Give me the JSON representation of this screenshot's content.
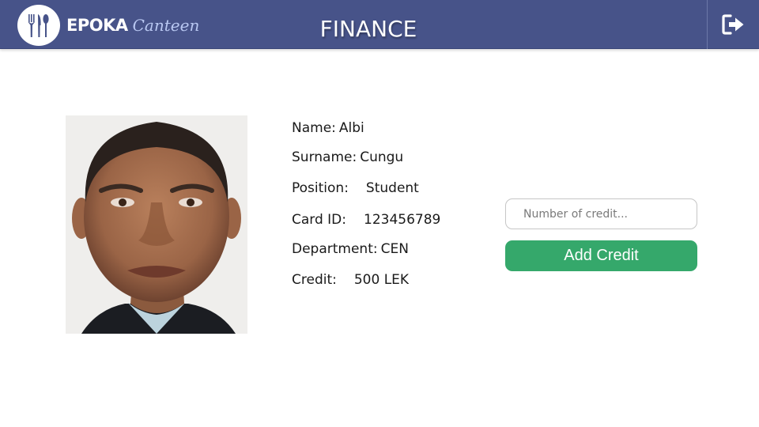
{
  "header": {
    "logo_brand": "EPOKA",
    "logo_sub": "Canteen",
    "title": "FINANCE",
    "logout_icon": "sign-out-icon"
  },
  "profile": {
    "photo_icon": "portrait-photo",
    "fields": [
      {
        "label": "Name:",
        "value": "Albi"
      },
      {
        "label": "Surname:",
        "value": "Cungu"
      },
      {
        "label": "Position:",
        "value": "Student"
      },
      {
        "label": "Card ID:",
        "value": "123456789"
      },
      {
        "label": "Department:",
        "value": "CEN"
      },
      {
        "label": "Credit:",
        "value": "500 LEK"
      }
    ]
  },
  "credit_form": {
    "input_placeholder": "Number of credit...",
    "input_value": "",
    "button_label": "Add Credit"
  },
  "colors": {
    "header_bg": "#475389",
    "button_bg": "#35a86b",
    "logo_sub": "#b9c8f2"
  }
}
